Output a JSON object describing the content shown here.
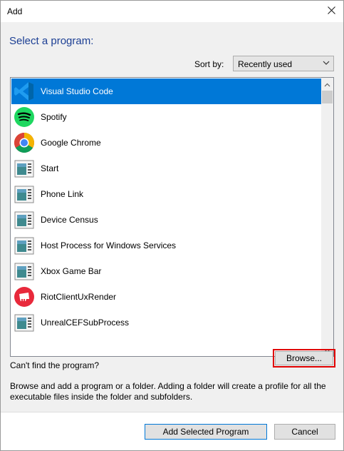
{
  "window": {
    "title": "Add"
  },
  "heading": "Select a program:",
  "sort": {
    "label": "Sort by:",
    "selected": "Recently used"
  },
  "programs": [
    {
      "name": "Visual Studio Code",
      "icon": "vscode-icon",
      "selected": true
    },
    {
      "name": "Spotify",
      "icon": "spotify-icon",
      "selected": false
    },
    {
      "name": "Google Chrome",
      "icon": "chrome-icon",
      "selected": false
    },
    {
      "name": "Start",
      "icon": "generic-app-icon",
      "selected": false
    },
    {
      "name": "Phone Link",
      "icon": "generic-app-icon",
      "selected": false
    },
    {
      "name": "Device Census",
      "icon": "generic-app-icon",
      "selected": false
    },
    {
      "name": "Host Process for Windows Services",
      "icon": "generic-app-icon",
      "selected": false
    },
    {
      "name": "Xbox Game Bar",
      "icon": "generic-app-icon",
      "selected": false
    },
    {
      "name": "RiotClientUxRender",
      "icon": "riot-icon",
      "selected": false
    },
    {
      "name": "UnrealCEFSubProcess",
      "icon": "generic-app-icon",
      "selected": false
    }
  ],
  "cant_find": "Can't find the program?",
  "browse_label": "Browse...",
  "description": "Browse and add a program or a folder. Adding a folder will create a profile for all the executable files inside the folder and subfolders.",
  "buttons": {
    "add": "Add Selected Program",
    "cancel": "Cancel"
  },
  "colors": {
    "selection": "#0078d7",
    "heading": "#1c3f94",
    "highlight_outline": "#e00000"
  }
}
